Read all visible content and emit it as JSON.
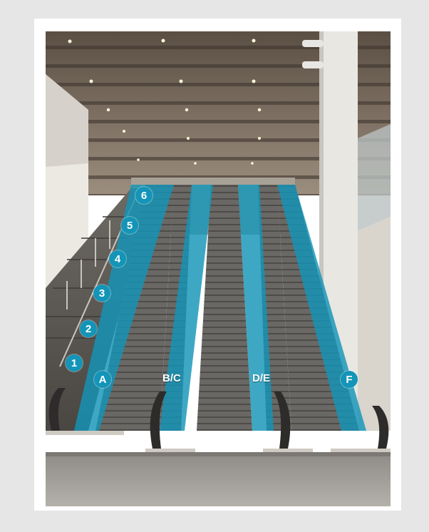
{
  "step_markers": [
    "1",
    "2",
    "3",
    "4",
    "5",
    "6"
  ],
  "escalator_labels": {
    "a": "A",
    "bc": "B/C",
    "de": "D/E",
    "f": "F"
  },
  "colors": {
    "highlight": "#1495b8",
    "background": "#e6e6e6",
    "frame": "#ffffff"
  }
}
